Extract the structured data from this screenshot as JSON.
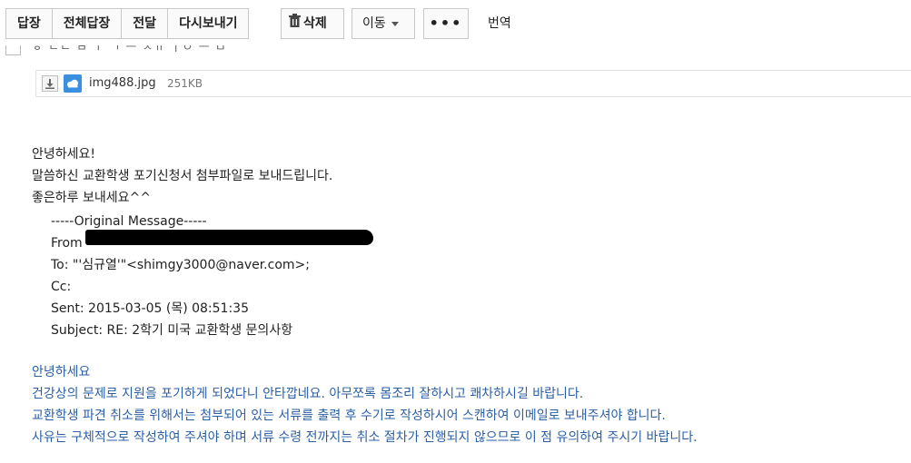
{
  "toolbar": {
    "reply": "답장",
    "reply_all": "전체답장",
    "forward": "전달",
    "resend": "다시보내기",
    "delete": "삭제",
    "move": "이동",
    "more": "•••",
    "translate": "번역"
  },
  "attachment": {
    "name": "img488.jpg",
    "size": "251KB"
  },
  "body": {
    "lines": [
      "안녕하세요!",
      "말씀하신 교환학생 포기신청서 첨부파일로 보내드립니다.",
      "좋은하루 보내세요^^"
    ]
  },
  "quoted": {
    "header": "-----Original Message-----",
    "from_label": "From",
    "to_label": "To:",
    "to_value": "\"'심규열'\"<shimgy3000@naver.com>;",
    "cc_label": "Cc:",
    "sent_label": "Sent:",
    "sent_value": "2015-03-05 (목) 08:51:35",
    "subject_label": "Subject:",
    "subject_value": "RE: 2학기 미국 교환학생 문의사항"
  },
  "reply": {
    "lines": [
      "안녕하세요",
      "건강상의 문제로 지원을 포기하게 되었다니 안타깝네요. 아무쪼록 몸조리 잘하시고 쾌차하시길 바랍니다.",
      "교환학생 파견 취소를 위해서는 첨부되어 있는 서류를 출력 후 수기로 작성하시어 스캔하여 이메일로 보내주셔야 합니다.",
      "사유는 구체적으로 작성하여 주셔야 하며 서류 수령 전까지는 취소 절차가 진행되지 않으므로 이 점 유의하여 주시기 바랍니다."
    ]
  },
  "colors": {
    "reply_text": "#2b5fa5",
    "cloud_icon": "#3b8fe0"
  },
  "icons": [
    "trash-icon",
    "caret-down-icon",
    "download-icon",
    "cloud-icon"
  ]
}
